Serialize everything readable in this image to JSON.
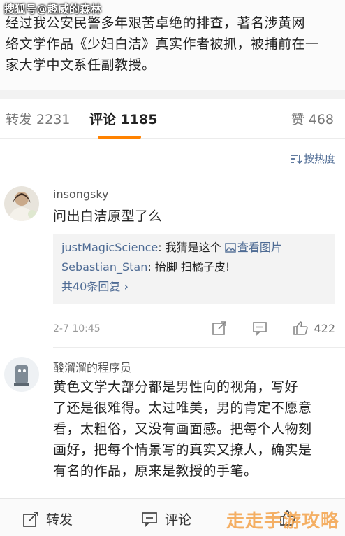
{
  "watermark_top": "搜狐号@趣威的森林",
  "post": {
    "lines": [
      "经过我公安民警多年艰苦卓绝的排查，著名涉黄网",
      "络文学作品《少妇白洁》真实作者被抓，被捕前在一",
      "家大学中文系任副教授。"
    ]
  },
  "tabs": {
    "repost": "转发 2231",
    "comment": "评论 1185",
    "like": "赞 468"
  },
  "sort_label": "按热度",
  "comments": [
    {
      "username": "insongsky",
      "text": "问出白洁原型了么",
      "replies": [
        {
          "user": "justMagicScience",
          "text": ": 我猜是这个 ",
          "link": "查看图片"
        },
        {
          "user": "Sebastian_Stan",
          "text": ": 抬脚 扫橘子皮!"
        }
      ],
      "more_replies": "共40条回复 ›",
      "time": "2-7 10:45",
      "likes": "422"
    },
    {
      "username": "酸溜溜的程序员",
      "lines": [
        "黄色文学大部分都是男性向的视角，写好",
        "了还是很难得。太过唯美，男的肯定不愿意",
        "看，太粗俗，又没有画面感。把每个人物刻",
        "画好，把每个情景写的真实又撩人，确实是",
        "有名的作品，原来是教授的手笔。"
      ]
    }
  ],
  "bottom_bar": {
    "repost": "转发",
    "comment": "评论"
  },
  "watermark_bottom": "走走手游攻略",
  "colors": {
    "accent": "#ff8200",
    "link": "#4e6b94"
  }
}
